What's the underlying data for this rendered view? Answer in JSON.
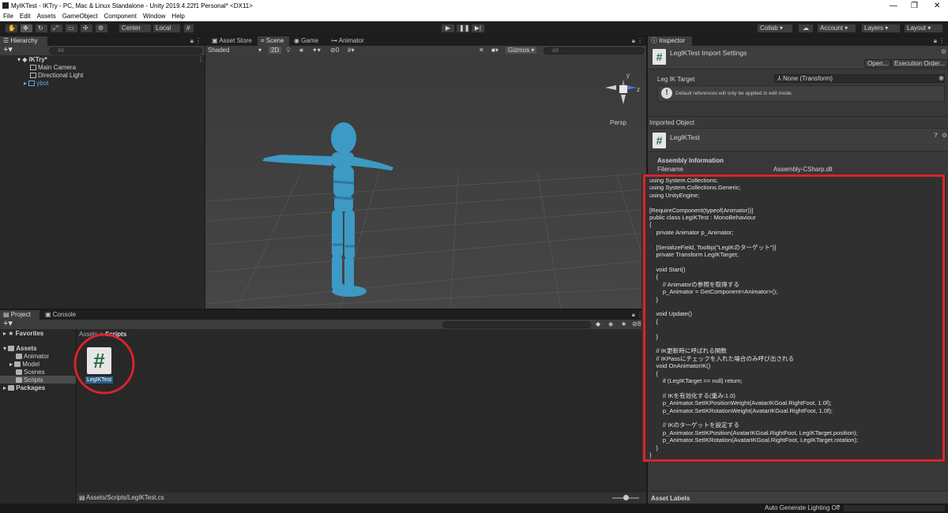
{
  "window": {
    "title": "MyIKTest - IKTry - PC, Mac & Linux Standalone - Unity 2019.4.22f1 Personal* <DX11>"
  },
  "menu": [
    "File",
    "Edit",
    "Assets",
    "GameObject",
    "Component",
    "Window",
    "Help"
  ],
  "toolbar": {
    "pivot": "Center",
    "space": "Local",
    "collab": "Collab ▾",
    "account": "Account",
    "layers": "Layers",
    "layout": "Layout"
  },
  "hierarchy": {
    "tab": "Hierarchy",
    "search_placeholder": "All",
    "scene": "IKTry*",
    "items": [
      "Main Camera",
      "Directional Light",
      "ybot"
    ]
  },
  "scene": {
    "tabs": [
      "Asset Store",
      "Scene",
      "Game",
      "Animator"
    ],
    "shading": "Shaded",
    "mode2d": "2D",
    "gizmos": "Gizmos",
    "search_placeholder": "All",
    "persp": "Persp",
    "hidden_count": "0"
  },
  "project": {
    "tabs": [
      "Project",
      "Console"
    ],
    "favorites": "Favorites",
    "assets": "Assets",
    "folders": [
      "Animator",
      "Model",
      "Scenes",
      "Scripts"
    ],
    "packages": "Packages",
    "breadcrumb": [
      "Assets",
      "Scripts"
    ],
    "asset_name": "LegIKTest",
    "path": "Assets/Scripts/LegIKTest.cs",
    "badge_count": "8"
  },
  "inspector": {
    "tab": "Inspector",
    "header": "LegIKTest Import Settings",
    "open": "Open...",
    "exec_order": "Execution Order...",
    "field_label": "Leg IK Target",
    "field_value": "None (Transform)",
    "info": "Default references will only be applied in edit mode.",
    "imported_object": "Imported Object",
    "object_name": "LegIKTest",
    "assembly_info": "Assembly Information",
    "filename_label": "Filename",
    "filename_value": "Assembly-CSharp.dll",
    "asset_labels": "Asset Labels",
    "code": "using System.Collections;\nusing System.Collections.Generic;\nusing UnityEngine;\n\n[RequireComponent(typeof(Animator))]\npublic class LegIKTest : MonoBehaviour\n{\n    private Animator p_Animator;\n\n    [SerializeField, Tooltip(\"LegIKのターゲット\")]\n    private Transform LegIKTarget;\n\n    void Start()\n    {\n        // Animatorの参照を取得する\n        p_Animator = GetComponent<Animator>();\n    }\n\n    void Update()\n    {\n\n    }\n\n    // IK更新時に呼ばれる関数\n    // IKPassにチェックを入れた場合のみ呼び出される\n    void OnAnimatorIK()\n    {\n        if (LegIKTarget == null) return;\n\n        // IKを有効化する(重み:1.0)\n        p_Animator.SetIKPositionWeight(AvatarIKGoal.RightFoot, 1.0f);\n        p_Animator.SetIKRotationWeight(AvatarIKGoal.RightFoot, 1.0f);\n\n        // IKのターゲットを設定する\n        p_Animator.SetIKPosition(AvatarIKGoal.RightFoot, LegIKTarget.position);\n        p_Animator.SetIKRotation(AvatarIKGoal.RightFoot, LegIKTarget.rotation);\n    }\n}"
  },
  "status": {
    "lighting": "Auto Generate Lighting Off"
  },
  "colors": {
    "highlight": "#d9242c",
    "selected": "#2c5d87",
    "model": "#3d9ac4"
  },
  "gizmo": {
    "y": "y",
    "z": "z"
  }
}
